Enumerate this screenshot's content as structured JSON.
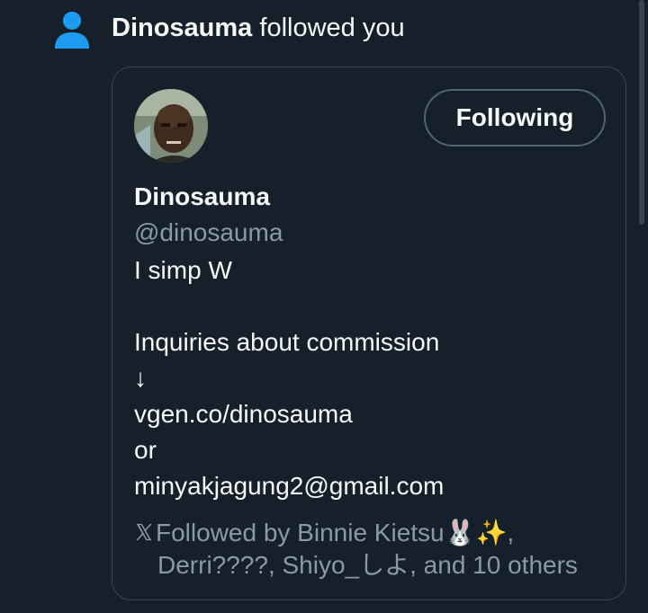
{
  "notification": {
    "user_name": "Dinosauma",
    "action_text": " followed you"
  },
  "profile_card": {
    "display_name": "Dinosauma",
    "handle": "@dinosauma",
    "follow_button_label": "Following",
    "bio": {
      "line1": "I simp W",
      "line2": "Inquiries about commission",
      "line3": "↓",
      "line4": "vgen.co/dinosauma",
      "line5": "or",
      "line6": "minyakjagung2@gmail.com"
    },
    "followed_by": {
      "line1": "Followed by Binnie Kietsu🐰✨,",
      "line2": "Derri????, Shiyo_しよ, and 10 others"
    }
  },
  "icons": {
    "notification_type": "person-icon",
    "followed_by": "x-logo-icon"
  },
  "colors": {
    "background": "#15202b",
    "accent_blue": "#1d9bf0",
    "text_primary": "#f7f9f9",
    "text_secondary": "#8b98a5",
    "border": "#38444d"
  }
}
